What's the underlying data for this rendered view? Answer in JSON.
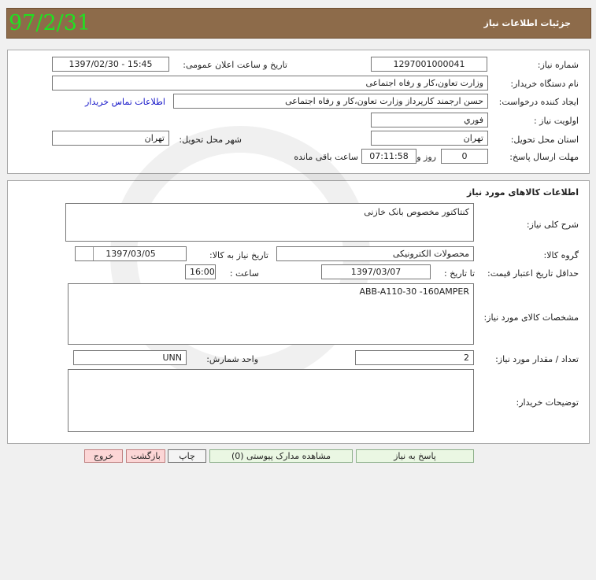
{
  "header": {
    "title": "جزئیات اطلاعات نیاز",
    "date_stamp": "97/2/31"
  },
  "info": {
    "need_number_label": "شماره نیاز:",
    "need_number": "1297001000041",
    "announce_label": "تاریخ و ساعت اعلان عمومی:",
    "announce_value": "1397/02/30 - 15:45",
    "buyer_org_label": "نام دستگاه خریدار:",
    "buyer_org": "وزارت تعاون،کار و رفاه اجتماعی",
    "creator_label": "ایجاد کننده درخواست:",
    "creator": "حسن ارجمند کارپرداز وزارت تعاون،کار و رفاه اجتماعی",
    "contact_link": "اطلاعات تماس خریدار",
    "priority_label": "اولویت نیاز :",
    "priority": "فوري",
    "province_label": "استان محل تحویل:",
    "province": "تهران",
    "city_label": "شهر محل تحویل:",
    "city": "تهران",
    "deadline_label": "مهلت ارسال پاسخ:",
    "deadline_days": "0",
    "days_word": "روز و",
    "deadline_time": "07:11:58",
    "remaining_word": "ساعت باقی مانده"
  },
  "goods": {
    "section_title": "اطلاعات کالاهای مورد نیاز",
    "desc_label": "شرح کلی نیاز:",
    "desc": "کنتاکتور  مخصوص بانک خازنی",
    "group_label": "گروه کالا:",
    "group": "محصولات الکترونیکی",
    "need_date_label": "تاریخ نیاز به کالا:",
    "need_date": "1397/03/05",
    "min_validity_label": "حداقل تاریخ اعتبار قیمت:",
    "to_date_label": "تا تاریخ :",
    "to_date": "1397/03/07",
    "hour_label": "ساعت :",
    "hour": "16:00",
    "spec_label": "مشخصات کالای مورد نیاز:",
    "spec": "ABB-A110-30     -160AMPER",
    "qty_label": "تعداد / مقدار مورد نیاز:",
    "qty": "2",
    "unit_label": "واحد شمارش:",
    "unit": "UNN",
    "buyer_notes_label": "توضیحات خریدار:",
    "buyer_notes": ""
  },
  "actions": {
    "reply": "پاسخ به نیاز",
    "attachments": "مشاهده مدارک پیوستی (0)",
    "print": "چاپ",
    "back": "بازگشت",
    "exit": "خروج"
  }
}
